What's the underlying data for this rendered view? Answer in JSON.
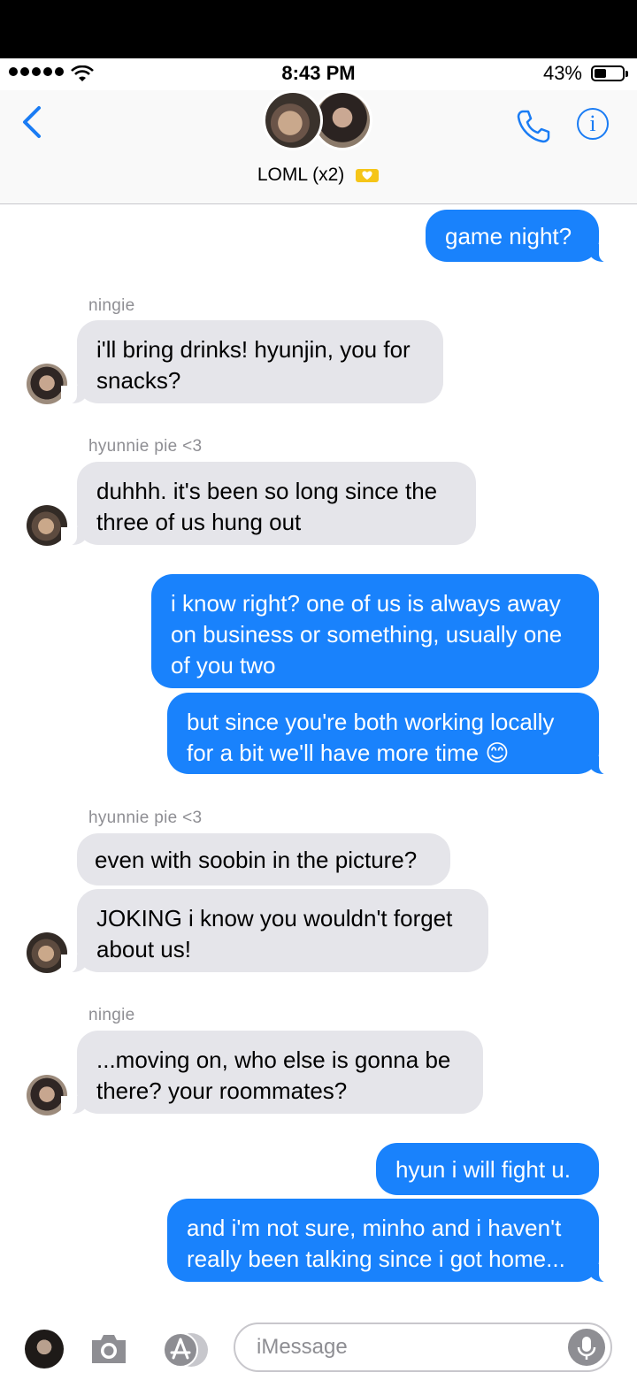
{
  "status_bar": {
    "time": "8:43 PM",
    "battery": "43%",
    "battery_level": 0.43
  },
  "header": {
    "title": "LOML (x2)",
    "icons": [
      "back-chevron-icon",
      "phone-icon",
      "info-icon",
      "heart-icon"
    ]
  },
  "messages": [
    {
      "type": "sent",
      "text": "game night?"
    },
    {
      "type": "recv",
      "sender": "ningie",
      "text": "i'll bring drinks! hyunjin, you for\nsnacks?"
    },
    {
      "type": "recv",
      "sender": "hyunnie pie <3",
      "text": "duhhh. it's been so long since the\nthree of us hung out"
    },
    {
      "type": "sent",
      "text": "i know right? one of us is always away\non business or something, usually one\nof you two"
    },
    {
      "type": "sent",
      "text": "but since you're both working locally\nfor a bit we'll have more time 😊"
    },
    {
      "type": "recv",
      "sender": "hyunnie pie <3",
      "text": "even with soobin in the picture?"
    },
    {
      "type": "recv",
      "text": "JOKING i know you wouldn't forget\nabout us!"
    },
    {
      "type": "recv",
      "sender": "ningie",
      "text": "...moving on, who else is gonna be\nthere? your roommates?"
    },
    {
      "type": "sent",
      "text": "hyun i will fight u."
    },
    {
      "type": "sent",
      "text": "and i'm not sure, minho and i haven't\nreally been talking since i got home..."
    }
  ],
  "compose": {
    "placeholder": "iMessage"
  },
  "colors": {
    "sent": "#1982fc",
    "received": "#e5e5ea",
    "accent": "#1a7cf4"
  }
}
